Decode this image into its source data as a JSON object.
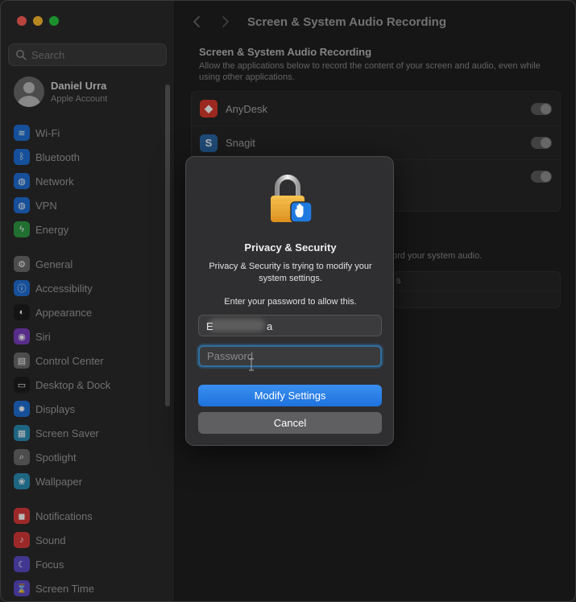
{
  "sidebar": {
    "search_placeholder": "Search",
    "account": {
      "name": "Daniel Urra",
      "subtitle": "Apple Account"
    },
    "items": [
      {
        "label": "Wi-Fi",
        "icon": "wifi-icon",
        "color": "#1f6fd6",
        "glyph": "≋"
      },
      {
        "label": "Bluetooth",
        "icon": "bluetooth-icon",
        "color": "#1f6fd6",
        "glyph": "ᛒ"
      },
      {
        "label": "Network",
        "icon": "network-icon",
        "color": "#1f6fd6",
        "glyph": "◍"
      },
      {
        "label": "VPN",
        "icon": "vpn-icon",
        "color": "#1f6fd6",
        "glyph": "◍"
      },
      {
        "label": "Energy",
        "icon": "energy-icon",
        "color": "#2e9b45",
        "glyph": "ϟ"
      },
      {
        "label": "General",
        "icon": "gear-icon",
        "color": "#6b6b6b",
        "glyph": "⚙"
      },
      {
        "label": "Accessibility",
        "icon": "accessibility-icon",
        "color": "#1f6fd6",
        "glyph": "ⓘ"
      },
      {
        "label": "Appearance",
        "icon": "appearance-icon",
        "color": "#1c1c1c",
        "glyph": "◐"
      },
      {
        "label": "Siri",
        "icon": "siri-icon",
        "color": "#7a3fbf",
        "glyph": "◉"
      },
      {
        "label": "Control Center",
        "icon": "control-center-icon",
        "color": "#6b6b6b",
        "glyph": "▤"
      },
      {
        "label": "Desktop & Dock",
        "icon": "desktop-dock-icon",
        "color": "#1c1c1c",
        "glyph": "▭"
      },
      {
        "label": "Displays",
        "icon": "displays-icon",
        "color": "#1f6fd6",
        "glyph": "✹"
      },
      {
        "label": "Screen Saver",
        "icon": "screen-saver-icon",
        "color": "#2a8db5",
        "glyph": "▦"
      },
      {
        "label": "Spotlight",
        "icon": "spotlight-icon",
        "color": "#6b6b6b",
        "glyph": "⌕"
      },
      {
        "label": "Wallpaper",
        "icon": "wallpaper-icon",
        "color": "#2a8db5",
        "glyph": "❀"
      },
      {
        "label": "Notifications",
        "icon": "notifications-icon",
        "color": "#d93a3a",
        "glyph": "◼"
      },
      {
        "label": "Sound",
        "icon": "sound-icon",
        "color": "#d93a3a",
        "glyph": "♪"
      },
      {
        "label": "Focus",
        "icon": "focus-icon",
        "color": "#5a4bc8",
        "glyph": "☾"
      },
      {
        "label": "Screen Time",
        "icon": "screen-time-icon",
        "color": "#5a4bc8",
        "glyph": "⌛"
      }
    ]
  },
  "toolbar": {
    "title": "Screen & System Audio Recording",
    "back_icon": "chevron-left-icon",
    "forward_icon": "chevron-right-icon"
  },
  "main": {
    "section_title": "Screen & System Audio Recording",
    "section_desc": "Allow the applications below to record the content of your screen and audio, even while using other applications.",
    "apps": [
      {
        "name": "AnyDesk",
        "icon": "anydesk-icon",
        "color": "#d8392b",
        "glyph": "◆"
      },
      {
        "name": "Snagit",
        "icon": "snagit-icon",
        "color": "#2b6aa8",
        "glyph": "S"
      },
      {
        "name": "",
        "icon": "app-icon",
        "color": "#555555",
        "glyph": ""
      }
    ],
    "section2_desc": "ord your system audio.",
    "list2_rows": [
      "s",
      ""
    ]
  },
  "dialog": {
    "title": "Privacy & Security",
    "message": "Privacy & Security is trying to modify your system settings.",
    "prompt": "Enter your password to allow this.",
    "username_start": "E",
    "username_end": "a",
    "password_placeholder": "Password",
    "primary_button": "Modify Settings",
    "cancel_button": "Cancel"
  }
}
